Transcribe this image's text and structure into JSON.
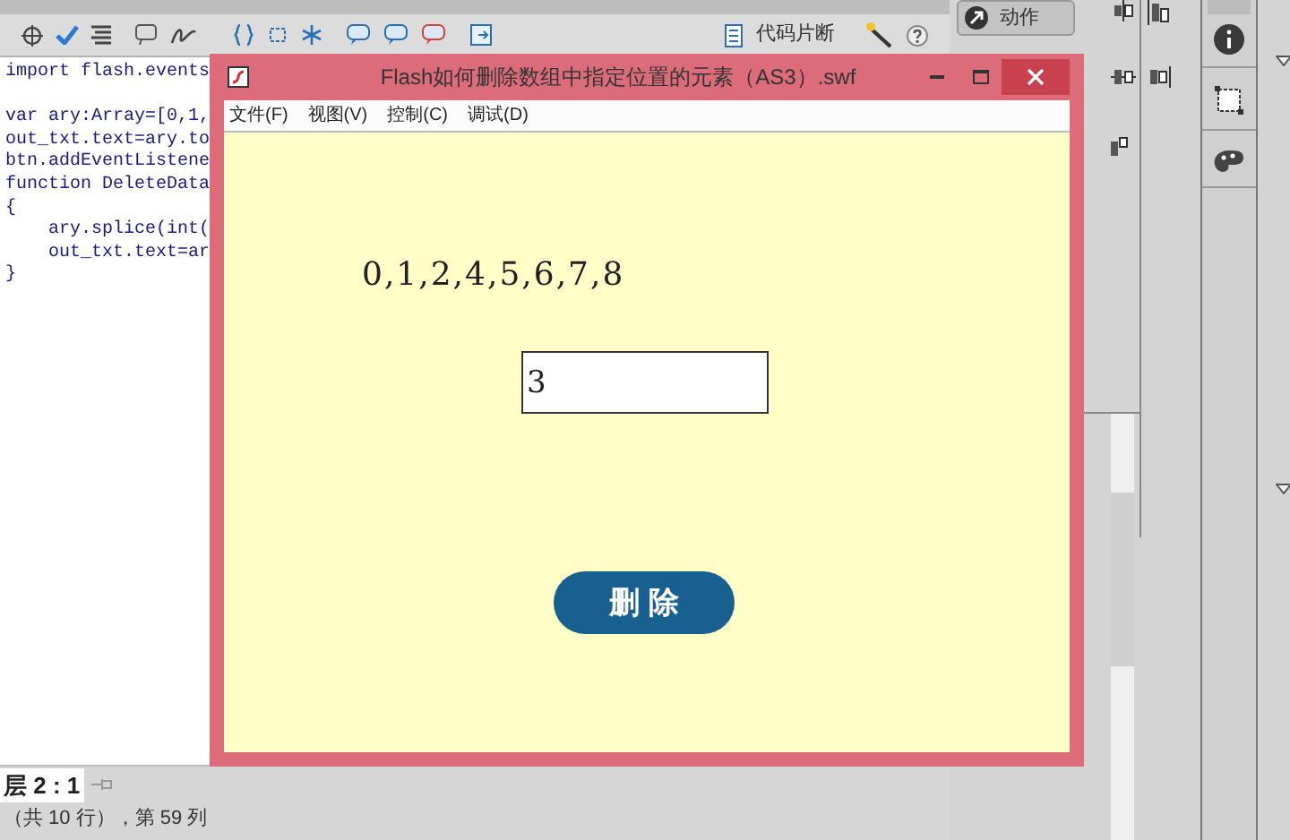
{
  "toolbar": {
    "snippets_label": "代码片断"
  },
  "code_blocks": [
    [
      "import flash.events"
    ],
    [
      "var ary:Array=[0,1,",
      "out_txt.text=ary.to",
      "btn.addEventListene",
      "function DeleteData",
      "{",
      "    ary.splice(int(",
      "    out_txt.text=ar",
      "}"
    ]
  ],
  "status": {
    "layer": "层 2 : 1",
    "position": "（共 10 行），第 59 列"
  },
  "actions_button": "动作",
  "window": {
    "title": "Flash如何删除数组中指定位置的元素（AS3）.swf",
    "menu": [
      "文件(F)",
      "视图(V)",
      "控制(C)",
      "调试(D)"
    ],
    "output": "0,1,2,4,5,6,7,8",
    "input_value": "3",
    "button": "删 除"
  }
}
